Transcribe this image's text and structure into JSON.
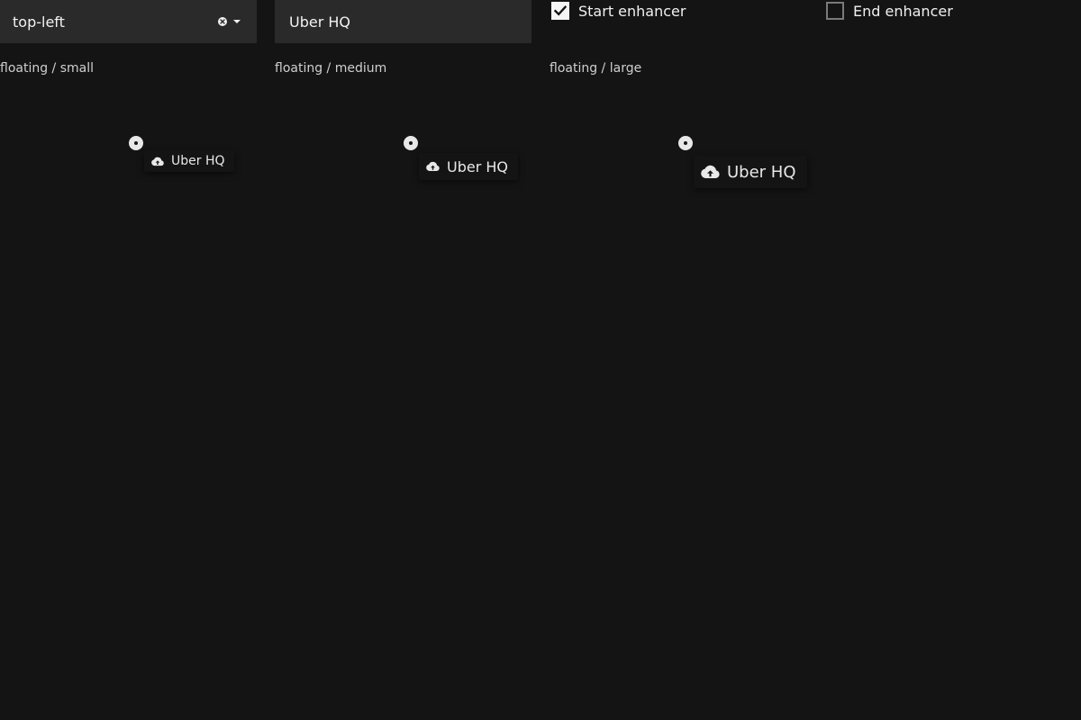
{
  "controls": {
    "placement_select": {
      "value": "top-left"
    },
    "label_input": {
      "value": "Uber HQ"
    },
    "start_enhancer": {
      "label": "Start enhancer",
      "checked": true
    },
    "end_enhancer": {
      "label": "End enhancer",
      "checked": false
    }
  },
  "sections": [
    {
      "label": "floating / small",
      "marker_label": "Uber HQ"
    },
    {
      "label": "floating / medium",
      "marker_label": "Uber HQ"
    },
    {
      "label": "floating / large",
      "marker_label": "Uber HQ"
    }
  ],
  "icons": {
    "marker_enhancer": "cloud-upload-icon",
    "clear": "clear-icon",
    "dropdown": "chevron-down-icon",
    "anchor": "anchor-dot-icon"
  },
  "colors": {
    "background": "#141414",
    "control_bg": "#2a2a2a",
    "text": "#e8e8e8"
  }
}
